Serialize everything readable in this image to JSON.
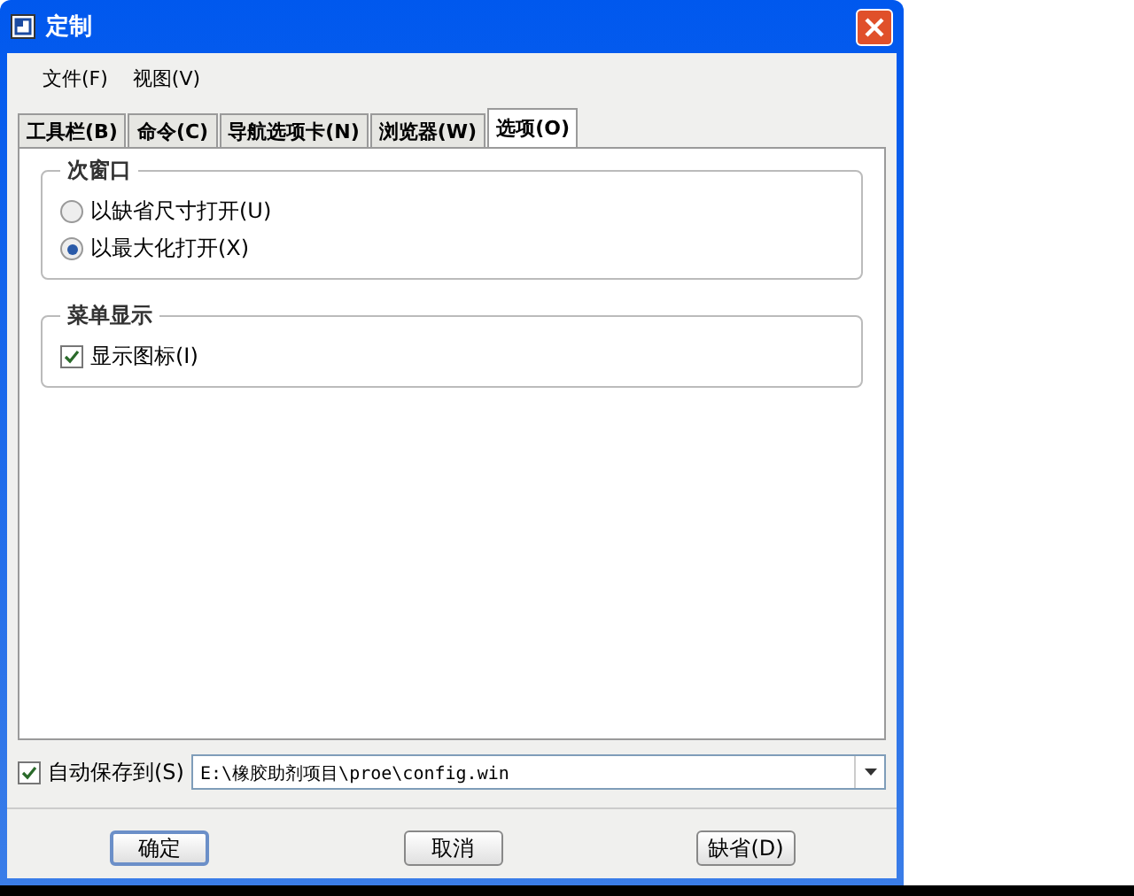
{
  "window": {
    "title": "定制"
  },
  "menu": [
    "文件(F)",
    "视图(V)"
  ],
  "tabs": [
    {
      "label": "工具栏(B)",
      "selected": false
    },
    {
      "label": "命令(C)",
      "selected": false
    },
    {
      "label": "导航选项卡(N)",
      "selected": false
    },
    {
      "label": "浏览器(W)",
      "selected": false
    },
    {
      "label": "选项(O)",
      "selected": true
    }
  ],
  "groups": [
    {
      "title": "次窗口",
      "items": [
        {
          "kind": "radio",
          "label": "以缺省尺寸打开(U)",
          "selected": false
        },
        {
          "kind": "radio",
          "label": "以最大化打开(X)",
          "selected": true
        }
      ]
    },
    {
      "title": "菜单显示",
      "items": [
        {
          "kind": "checkbox",
          "label": "显示图标(I)",
          "checked": true
        }
      ]
    }
  ],
  "autosave": {
    "label": "自动保存到(S)",
    "checked": true,
    "value": "E:\\橡胶助剂项目\\proe\\config.win"
  },
  "buttons": [
    {
      "label": "确定",
      "default": true
    },
    {
      "label": "取消",
      "default": false
    },
    {
      "label": "缺省(D)",
      "default": false
    }
  ]
}
